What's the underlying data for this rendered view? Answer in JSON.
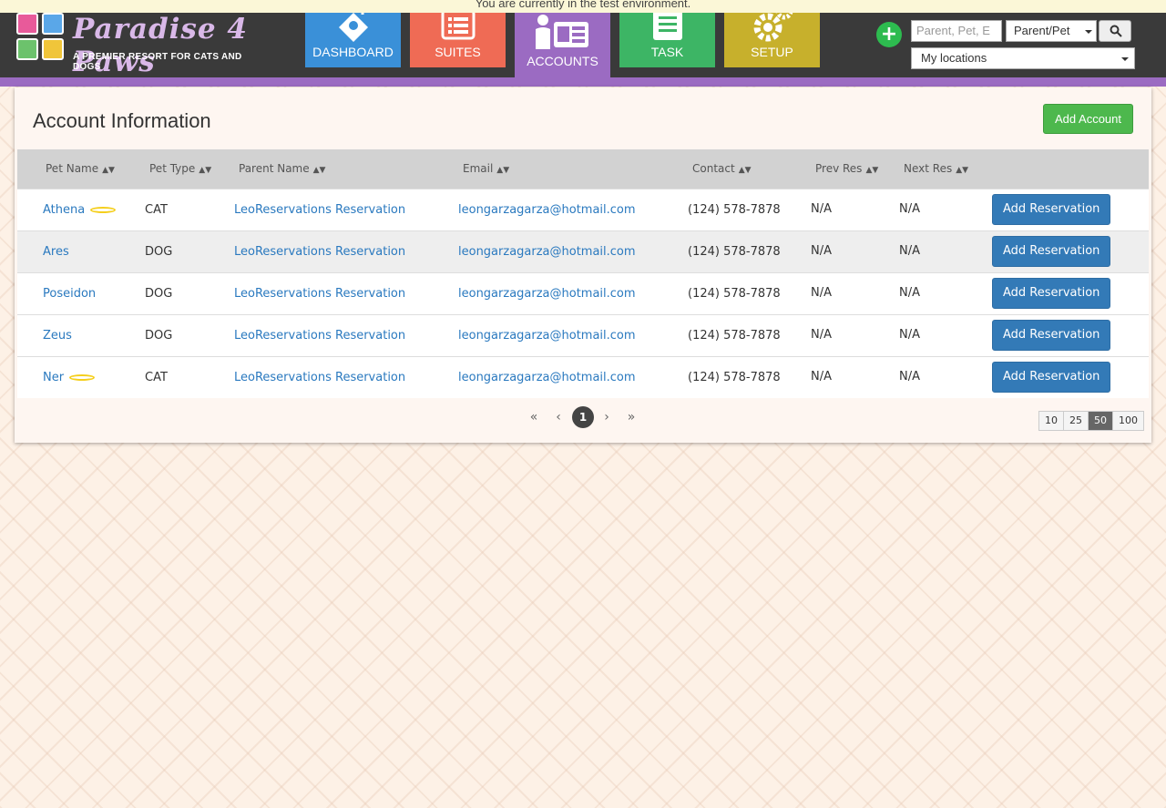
{
  "banner": {
    "text": "You are currently in the test environment."
  },
  "logo": {
    "title": "Paradise 4 Paws",
    "subtitle": "A PREMIER RESORT FOR CATS AND DOGS"
  },
  "nav": {
    "items": [
      {
        "label": "DASHBOARD",
        "color": "#3a90d8"
      },
      {
        "label": "SUITES",
        "color": "#ef6b55"
      },
      {
        "label": "ACCOUNTS",
        "color": "#9b6bc2"
      },
      {
        "label": "TASK",
        "color": "#3db565"
      },
      {
        "label": "SETUP",
        "color": "#c7b02c"
      }
    ]
  },
  "search": {
    "placeholder": "Parent, Pet, E",
    "type_select": "Parent/Pet",
    "location_select": "My locations"
  },
  "panel": {
    "title": "Account Information",
    "add_account_label": "Add Account"
  },
  "table": {
    "headers": [
      "Pet Name",
      "Pet Type",
      "Parent Name",
      "Email",
      "Contact",
      "Prev Res",
      "Next Res"
    ],
    "rows": [
      {
        "pet_name": "Athena",
        "halo": true,
        "pet_type": "CAT",
        "parent_name": "LeoReservations Reservation",
        "email": "leongarzagarza@hotmail.com",
        "contact": "(124) 578-7878",
        "prev_res": "N/A",
        "next_res": "N/A",
        "action": "Add Reservation"
      },
      {
        "pet_name": "Ares",
        "halo": false,
        "pet_type": "DOG",
        "parent_name": "LeoReservations Reservation",
        "email": "leongarzagarza@hotmail.com",
        "contact": "(124) 578-7878",
        "prev_res": "N/A",
        "next_res": "N/A",
        "action": "Add Reservation"
      },
      {
        "pet_name": "Poseidon",
        "halo": false,
        "pet_type": "DOG",
        "parent_name": "LeoReservations Reservation",
        "email": "leongarzagarza@hotmail.com",
        "contact": "(124) 578-7878",
        "prev_res": "N/A",
        "next_res": "N/A",
        "action": "Add Reservation"
      },
      {
        "pet_name": "Zeus",
        "halo": false,
        "pet_type": "DOG",
        "parent_name": "LeoReservations Reservation",
        "email": "leongarzagarza@hotmail.com",
        "contact": "(124) 578-7878",
        "prev_res": "N/A",
        "next_res": "N/A",
        "action": "Add Reservation"
      },
      {
        "pet_name": "Ner",
        "halo": true,
        "pet_type": "CAT",
        "parent_name": "LeoReservations Reservation",
        "email": "leongarzagarza@hotmail.com",
        "contact": "(124) 578-7878",
        "prev_res": "N/A",
        "next_res": "N/A",
        "action": "Add Reservation"
      }
    ]
  },
  "pagination": {
    "first": "«",
    "prev": "‹",
    "current": "1",
    "next": "›",
    "last": "»",
    "page_sizes": [
      "10",
      "25",
      "50",
      "100"
    ],
    "active_size": "50"
  }
}
